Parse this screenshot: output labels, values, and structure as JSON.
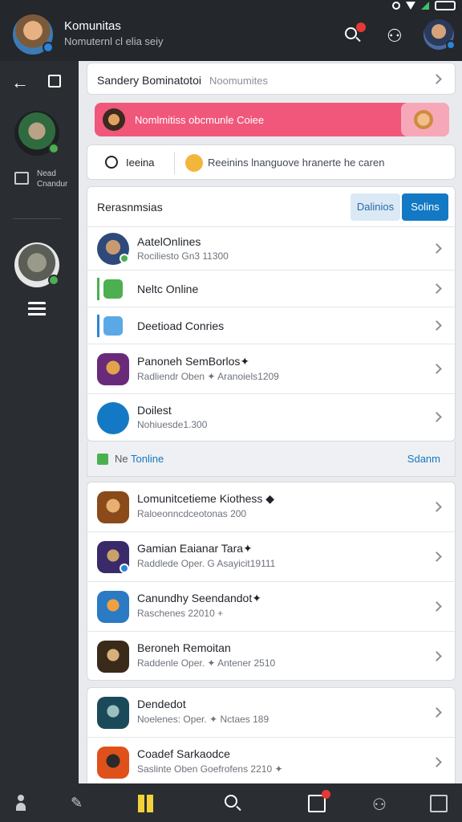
{
  "header": {
    "title": "Komunitas",
    "subtitle": "Nomuternl cl elia seiy"
  },
  "sidebar": {
    "field_label_1": "Nead",
    "field_label_2": "Cnandur"
  },
  "search": {
    "label": "Sandery Bominatotoi",
    "placeholder": "Noomumites"
  },
  "banner": {
    "text": "Nomlmitiss obcmunle Coiee"
  },
  "status": {
    "label": "Ieeina",
    "message": "Reeinins lnanguove hranerte he caren"
  },
  "list": {
    "title": "Rerasnmsias",
    "tab_a": "Dalinios",
    "tab_b": "Solins",
    "rows": [
      {
        "title": "AatelOnlines",
        "sub": "Rociliesto Gn3 11300"
      },
      {
        "title": "Neltc Online",
        "sub": ""
      },
      {
        "title": "Deetioad Conries",
        "sub": ""
      },
      {
        "title": "Panoneh SemBorlos✦",
        "sub": "Radliendr Oben ✦ Aranoiels1209"
      },
      {
        "title": "Doilest",
        "sub": "Nohiuesde1.300"
      }
    ],
    "footer_label_a": "Ne",
    "footer_label_b": "Tonline",
    "footer_action": "Sdanm"
  },
  "games": {
    "rows": [
      {
        "title": "Lomunitcetieme Kiothess ◆",
        "sub": "Raloeonncdceotonas 200"
      },
      {
        "title": "Gamian Eaianar Tara✦",
        "sub": "Raddlede Oper. G Asayicit19111"
      },
      {
        "title": "Canundhy Seendandot✦",
        "sub": "Raschenes 22010 +"
      },
      {
        "title": "Beroneh Remoitan",
        "sub": "Raddenle Oper. ✦ Antener 2510"
      }
    ],
    "rows2": [
      {
        "title": "Dendedot",
        "sub": "Noelenes: Oper. ✦ Nctaes 189"
      },
      {
        "title": "Coadef Sarkaodce",
        "sub": "Saslinte Oben Goefrofens 2210 ✦"
      }
    ]
  }
}
